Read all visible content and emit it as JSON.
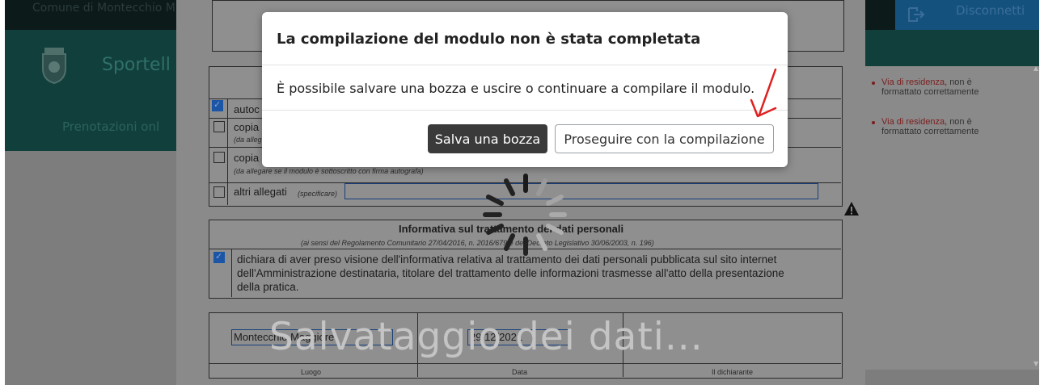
{
  "header": {
    "municipality": "Comune di Montecchio M",
    "logout_label": "Disconnetti",
    "portal_title": "Sportell",
    "nav_item": "Prenotazioni onl"
  },
  "form": {
    "attachments": {
      "item1_label": "autoc",
      "item1_checked": true,
      "item2_label": "copia",
      "item2_note": "(da alleg",
      "item3_label": "copia",
      "item3_note": "(da allegare se il modulo è sottoscritto con firma autografa)",
      "item4_label": "altri allegati",
      "item4_hint": "(specificare)"
    },
    "privacy": {
      "title": "Informativa sul trattamento dei dati personali",
      "subtitle": "(ai sensi del Regolamento Comunitario 27/04/2016, n. 2016/679 e del Decreto Legislativo 30/06/2003, n. 196)",
      "declaration_line1": "dichiara di aver preso visione dell'informativa relativa al trattamento dei dati personali pubblicata sul sito internet",
      "declaration_line2": "dell'Amministrazione destinataria, titolare del trattamento delle informazioni trasmesse all'atto della presentazione",
      "declaration_line3": "della pratica.",
      "checked": true
    },
    "signature": {
      "place_value": "Montecchio Maggiore",
      "date_value": "29/12/2021",
      "place_label": "Luogo",
      "date_label": "Data",
      "signer_label": "Il dichiarante"
    }
  },
  "validation_panel": {
    "errors": [
      {
        "link": "Via di residenza",
        "message1": ", non è",
        "message2": "formattato correttamente"
      },
      {
        "link": "Via di residenza",
        "message1": ", non è",
        "message2": "formattato correttamente"
      }
    ]
  },
  "overlay": {
    "saving_text": "Salvataggio dei dati..."
  },
  "modal": {
    "title": "La compilazione del modulo non è stata completata",
    "body": "È possibile salvare una bozza e uscire o continuare a compilare il modulo.",
    "save_draft_label": "Salva una bozza",
    "continue_label": "Proseguire con la compilazione"
  },
  "colors": {
    "accent_dark": "#3a3a3a",
    "annotation_red": "#e02020",
    "error_link": "#7c1e1e"
  }
}
